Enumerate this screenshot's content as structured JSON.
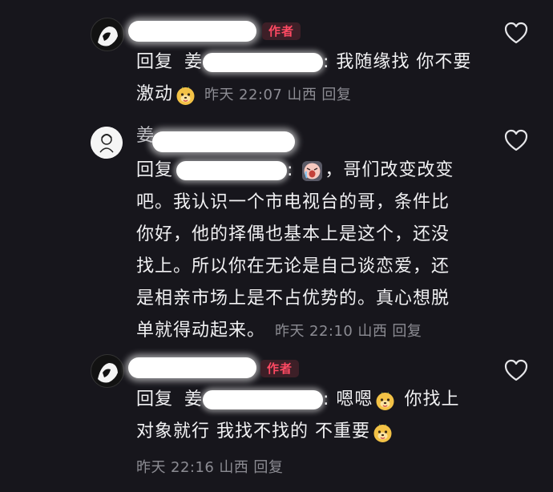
{
  "comments": [
    {
      "author_badge": "作者",
      "reply_prefix": "回复",
      "reply_name_initial": "姜",
      "lines": [
        ": 我随缘找  你不要",
        "激动"
      ],
      "meta": {
        "date": "昨天",
        "time": "22:07",
        "location": "山西",
        "reply_action": "回复"
      }
    },
    {
      "author_first_char": "姜",
      "reply_prefix": "回复",
      "lines": [
        ": ",
        "，哥们改变改变",
        "吧。我认识一个市电视台的哥，条件比",
        "你好，他的择偶也基本上是这个，还没",
        "找上。所以你在无论是自己谈恋爱，还",
        "是相亲市场上是不占优势的。真心想脱",
        "单就得动起来。"
      ],
      "meta": {
        "date": "昨天",
        "time": "22:10",
        "location": "山西",
        "reply_action": "回复"
      }
    },
    {
      "author_badge": "作者",
      "reply_prefix": "回复",
      "reply_name_initial": "姜",
      "lines": [
        ": 嗯嗯",
        "你找上",
        "对象就行  我找不找的  不重要"
      ],
      "meta": {
        "date": "昨天",
        "time": "22:16",
        "location": "山西",
        "reply_action": "回复"
      }
    }
  ],
  "icons": {
    "like": "heart-outline-icon",
    "emoji_dog": "dog-face-emoji-icon",
    "emoji_cry": "crying-face-emoji-icon"
  },
  "colors": {
    "background": "#17161c",
    "author_badge_text": "#ff4a63",
    "author_badge_bg": "#3d1f27",
    "meta_text": "#8c8c93"
  }
}
